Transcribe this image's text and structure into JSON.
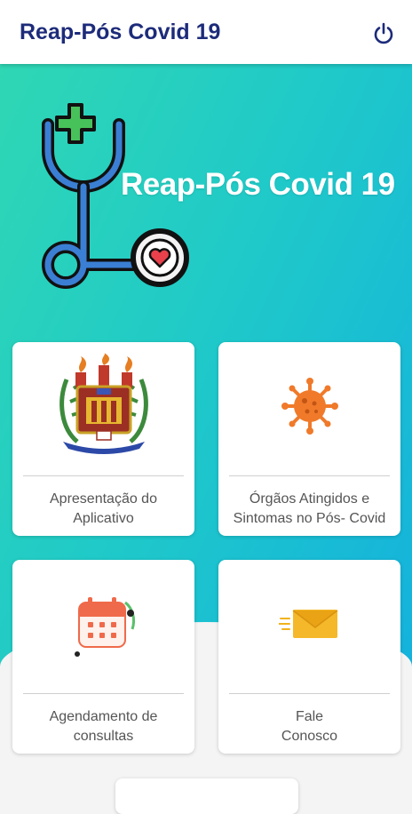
{
  "app": {
    "title": "Reap-Pós Covid 19"
  },
  "header": {
    "power_icon": "power-icon"
  },
  "hero": {
    "title": "Reap-Pós Covid 19",
    "logo_icon": "stethoscope-heart-logo"
  },
  "cards": [
    {
      "label": "Apresentação do\nAplicativo",
      "icon": "university-crest-icon"
    },
    {
      "label": "Órgãos Atingidos e\nSintomas no Pós- Covid",
      "icon": "virus-icon"
    },
    {
      "label": "Agendamento de\nconsultas",
      "icon": "calendar-icon"
    },
    {
      "label": "Fale\nConosco",
      "icon": "envelope-icon"
    }
  ],
  "colors": {
    "appbar_title": "#1d2b7a",
    "gradient_start": "#2fd7b4",
    "gradient_end": "#12aee0",
    "virus": "#f07a2a",
    "calendar": "#ef6a4a",
    "envelope": "#f2b31b"
  }
}
